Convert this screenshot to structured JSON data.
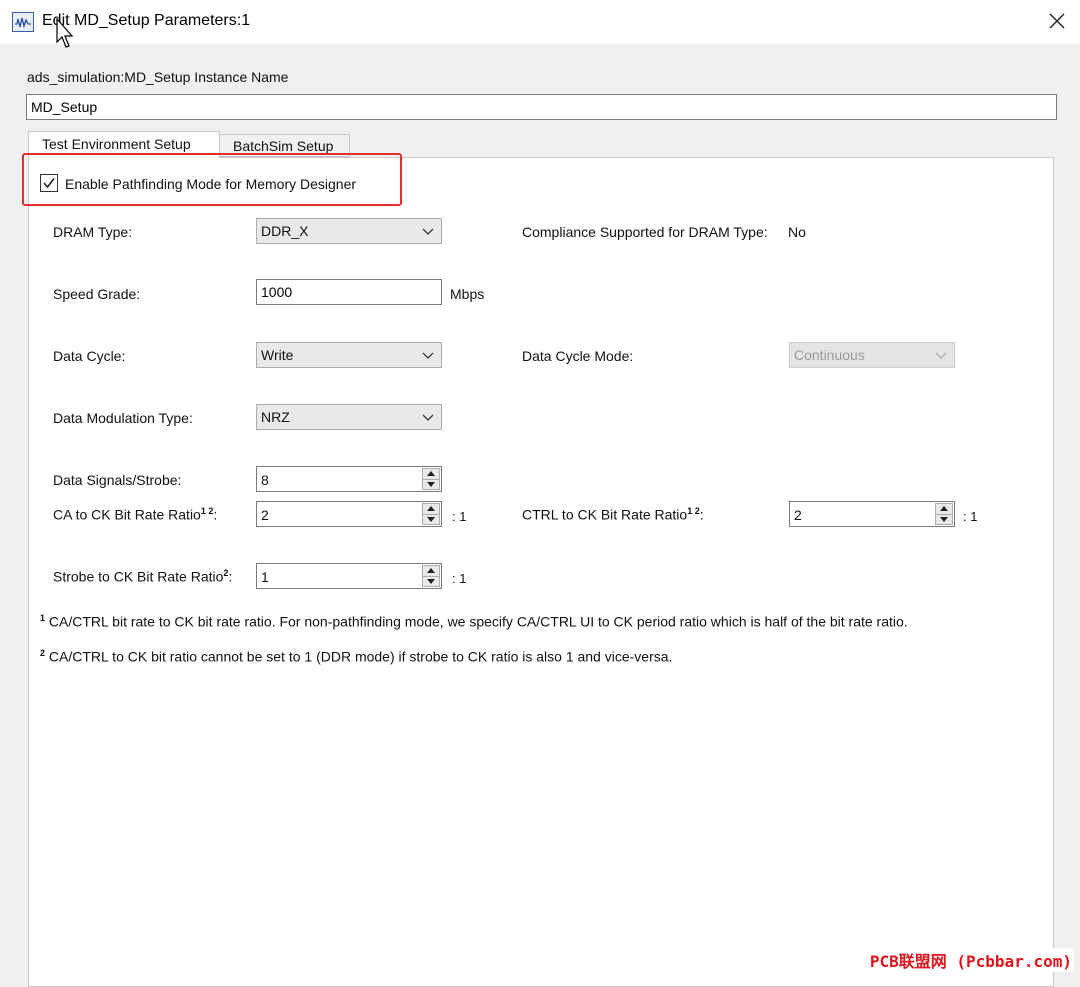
{
  "window": {
    "title": "Edit MD_Setup Parameters:1"
  },
  "instance": {
    "label": "ads_simulation:MD_Setup Instance Name",
    "value": "MD_Setup"
  },
  "tabs": [
    {
      "label": "Test Environment Setup",
      "active": true
    },
    {
      "label": "BatchSim Setup",
      "active": false
    }
  ],
  "pathfinding": {
    "label": "Enable Pathfinding Mode for Memory Designer",
    "checked": true
  },
  "fields": {
    "dram_type": {
      "label": "DRAM Type:",
      "value": "DDR_X"
    },
    "compliance": {
      "label": "Compliance Supported for DRAM Type:",
      "value": "No"
    },
    "speed_grade": {
      "label": "Speed Grade:",
      "value": "1000",
      "unit": "Mbps"
    },
    "data_cycle": {
      "label": "Data Cycle:",
      "value": "Write"
    },
    "data_cycle_mode": {
      "label": "Data Cycle Mode:",
      "value": "Continuous"
    },
    "data_modulation": {
      "label": "Data Modulation Type:",
      "value": "NRZ"
    },
    "data_signals": {
      "label": "Data Signals/Strobe:",
      "value": "8"
    },
    "ca_ratio": {
      "label": "CA to CK Bit Rate Ratio",
      "sup": "1 2",
      "colon": ":",
      "value": "2",
      "suffix": ": 1"
    },
    "ctrl_ratio": {
      "label": "CTRL to CK Bit Rate Ratio",
      "sup": "1 2",
      "colon": ":",
      "value": "2",
      "suffix": ": 1"
    },
    "strobe_ratio": {
      "label": "Strobe to CK Bit Rate Ratio",
      "sup": "2",
      "colon": ":",
      "value": "1",
      "suffix": ": 1"
    }
  },
  "notes": [
    {
      "mark": "1",
      "text": "CA/CTRL bit rate to CK bit rate ratio. For non-pathfinding mode, we specify CA/CTRL UI to CK period ratio which is half of the bit rate ratio."
    },
    {
      "mark": "2",
      "text": "CA/CTRL to CK bit ratio cannot be set to 1 (DDR mode) if strobe to CK ratio is also 1 and vice-versa."
    }
  ],
  "watermark": "PCB联盟网 (Pcbbar.com)",
  "icons": {
    "app": "waveform-app-icon",
    "close": "close-icon",
    "check": "checkmark-icon",
    "dropdown": "chevron-down-icon",
    "spin_up": "arrow-up-icon",
    "spin_down": "arrow-down-icon",
    "cursor": "mouse-cursor-icon"
  },
  "colors": {
    "highlight": "#e03030",
    "watermark": "#e0141e"
  }
}
